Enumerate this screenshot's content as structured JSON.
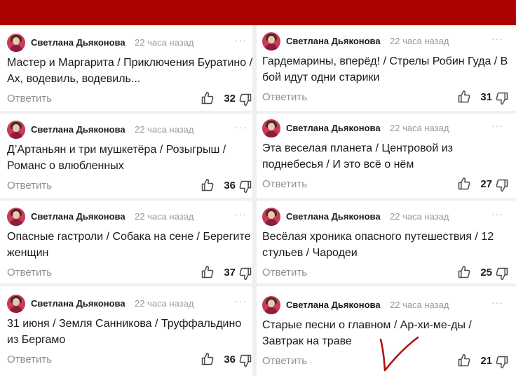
{
  "comments": [
    {
      "author": "Светлана Дьяконова",
      "time": "22 часа назад",
      "text": "Мастер и Маргарита / Приключения Буратино / Ах, водевиль, водевиль...",
      "reply": "Ответить",
      "likes": "32"
    },
    {
      "author": "Светлана Дьяконова",
      "time": "22 часа назад",
      "text": "Гардемарины, вперёд! / Стрелы Робин Гуда / В бой идут одни старики",
      "reply": "Ответить",
      "likes": "31"
    },
    {
      "author": "Светлана Дьяконова",
      "time": "22 часа назад",
      "text": "Д’Артаньян и три мушкетёра / Розыгрыш / Романс о влюбленных",
      "reply": "Ответить",
      "likes": "36"
    },
    {
      "author": "Светлана Дьяконова",
      "time": "22 часа назад",
      "text": "Эта веселая планета / Центровой из поднебесья / И это всё о нём",
      "reply": "Ответить",
      "likes": "27"
    },
    {
      "author": "Светлана Дьяконова",
      "time": "22 часа назад",
      "text": "Опасные гастроли / Собака на сене / Берегите женщин",
      "reply": "Ответить",
      "likes": "37"
    },
    {
      "author": "Светлана Дьяконова",
      "time": "22 часа назад",
      "text": "Весёлая хроника опасного путешествия / 12 стульев / Чародеи",
      "reply": "Ответить",
      "likes": "25"
    },
    {
      "author": "Светлана Дьяконова",
      "time": "22 часа назад",
      "text": "31 июня / Земля Санникова / Труффальдино из Бергамо",
      "reply": "Ответить",
      "likes": "36"
    },
    {
      "author": "Светлана Дьяконова",
      "time": "22 часа назад",
      "text": "Старые песни о главном / Ар-хи-ме-ды / Завтрак на траве",
      "reply": "Ответить",
      "likes": "21"
    }
  ],
  "icons": {
    "more": "more-dots-icon",
    "like": "thumbs-up-icon",
    "dislike": "thumbs-down-icon"
  },
  "colors": {
    "top_bar": "#ad0000",
    "checkmark": "#b01212",
    "time": "#9a9a9a"
  }
}
